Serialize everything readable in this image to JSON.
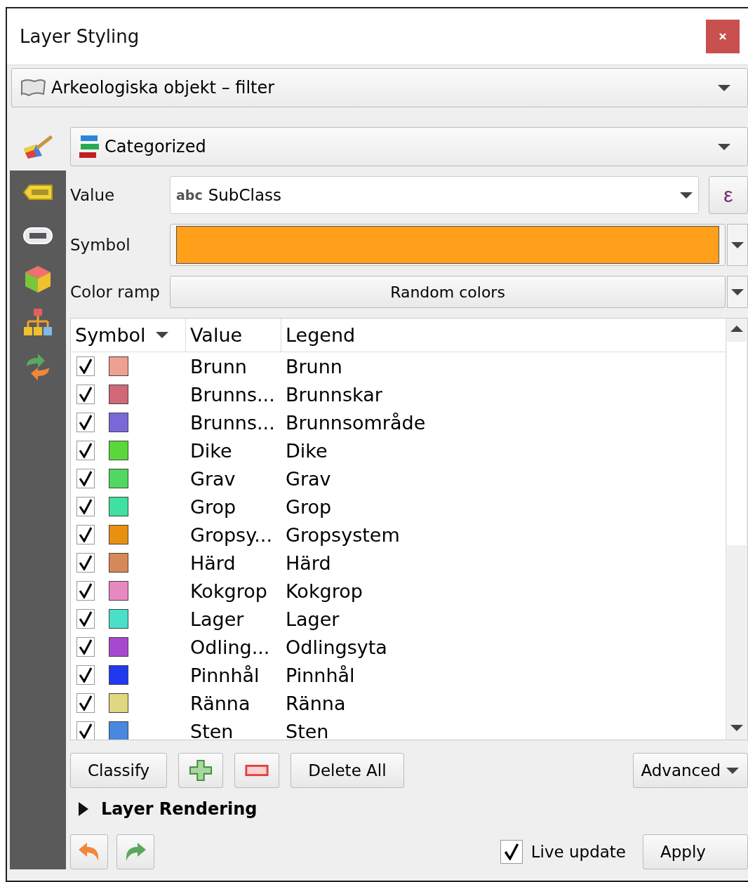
{
  "window": {
    "title": "Layer Styling"
  },
  "layer_selector": {
    "value": "Arkeologiska objekt – filter"
  },
  "side_tabs": [
    {
      "selected": true
    },
    {
      "selected": false
    },
    {
      "selected": false
    },
    {
      "selected": false
    },
    {
      "selected": false
    },
    {
      "selected": false
    }
  ],
  "renderer": {
    "value": "Categorized"
  },
  "value_field": {
    "label": "Value",
    "type_badge": "abc",
    "value": "SubClass",
    "expression_button": "ε"
  },
  "symbol": {
    "label": "Symbol",
    "color": "#ff9f1a"
  },
  "color_ramp": {
    "label": "Color ramp",
    "value": "Random colors"
  },
  "table": {
    "columns": [
      "Symbol",
      "Value",
      "Legend"
    ],
    "rows": [
      {
        "checked": true,
        "color": "#f0a090",
        "value": "Brunn",
        "legend": "Brunn"
      },
      {
        "checked": true,
        "color": "#d06878",
        "value": "Brunns...",
        "legend": "Brunnskar"
      },
      {
        "checked": true,
        "color": "#7b68d8",
        "value": "Brunns...",
        "legend": "Brunnsområde"
      },
      {
        "checked": true,
        "color": "#5ad83a",
        "value": "Dike",
        "legend": "Dike"
      },
      {
        "checked": true,
        "color": "#50d860",
        "value": "Grav",
        "legend": "Grav"
      },
      {
        "checked": true,
        "color": "#40e0a0",
        "value": "Grop",
        "legend": "Grop"
      },
      {
        "checked": true,
        "color": "#e89010",
        "value": "Gropsy...",
        "legend": "Gropsystem"
      },
      {
        "checked": true,
        "color": "#d88858",
        "value": "Härd",
        "legend": "Härd"
      },
      {
        "checked": true,
        "color": "#e888c0",
        "value": "Kokgrop",
        "legend": "Kokgrop"
      },
      {
        "checked": true,
        "color": "#48e0c8",
        "value": "Lager",
        "legend": "Lager"
      },
      {
        "checked": true,
        "color": "#a848d0",
        "value": "Odling...",
        "legend": "Odlingsyta"
      },
      {
        "checked": true,
        "color": "#2038f0",
        "value": "Pinnhål",
        "legend": "Pinnhål"
      },
      {
        "checked": true,
        "color": "#e0d880",
        "value": "Ränna",
        "legend": "Ränna"
      },
      {
        "checked": true,
        "color": "#4888e0",
        "value": "Sten",
        "legend": "Sten"
      }
    ]
  },
  "buttons": {
    "classify": "Classify",
    "delete_all": "Delete All",
    "advanced": "Advanced"
  },
  "layer_rendering": {
    "label": "Layer Rendering",
    "expanded": false
  },
  "live_update": {
    "label": "Live update",
    "checked": true
  },
  "apply": "Apply"
}
